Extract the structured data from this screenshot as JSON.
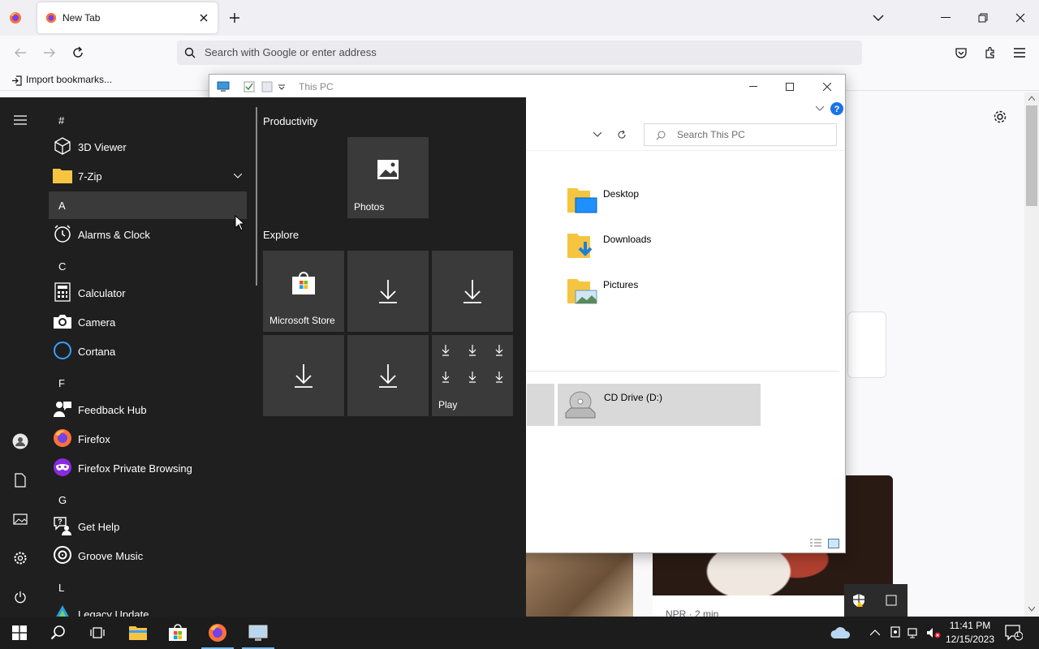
{
  "browser": {
    "tab_title": "New Tab",
    "url_placeholder": "Search with Google or enter address",
    "bookmark_import": "Import bookmarks...",
    "card_meta": "NPR · 2 min"
  },
  "explorer": {
    "window_title": "This PC",
    "search_placeholder": "Search This PC",
    "folders": [
      "Desktop",
      "Downloads",
      "Pictures"
    ],
    "drive_label": "CD Drive (D:)"
  },
  "start_menu": {
    "groups": {
      "hash": "#",
      "a": "A",
      "c": "C",
      "f": "F",
      "g": "G",
      "l": "L"
    },
    "apps": {
      "viewer3d": "3D Viewer",
      "zip": "7-Zip",
      "alarms": "Alarms & Clock",
      "calculator": "Calculator",
      "camera": "Camera",
      "cortana": "Cortana",
      "feedback": "Feedback Hub",
      "firefox": "Firefox",
      "firefox_private": "Firefox Private Browsing",
      "gethelp": "Get Help",
      "groove": "Groove Music",
      "legacy": "Legacy Update"
    },
    "tile_groups": {
      "productivity": "Productivity",
      "explore": "Explore"
    },
    "tiles": {
      "photos": "Photos",
      "store": "Microsoft Store",
      "play": "Play"
    }
  },
  "taskbar": {
    "time": "11:41 PM",
    "date": "12/15/2023",
    "notification_count": "1"
  },
  "colors": {
    "accent": "#0078d4",
    "start_bg": "#1f1f1f",
    "tile_bg": "#3a3a3a",
    "taskbar_bg": "#1c1c1c"
  }
}
